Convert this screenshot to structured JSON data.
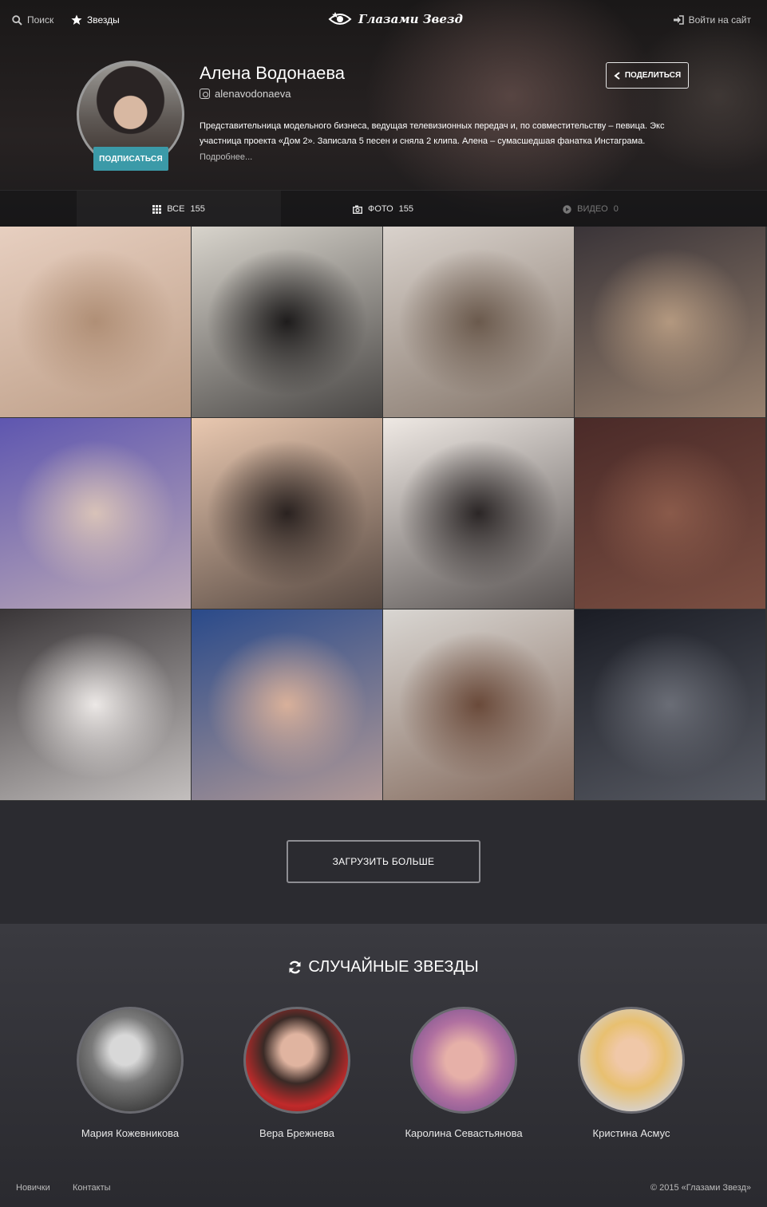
{
  "topbar": {
    "search_label": "Поиск",
    "stars_label": "Звезды",
    "logo_text": "Глазами Звезд",
    "login_label": "Войти на сайт"
  },
  "profile": {
    "name": "Алена Водонаева",
    "handle": "alenavodonaeva",
    "bio": "Представительница модельного бизнеса, ведущая телевизионных передач и, по совместительству – певица. Экс участница проекта «Дом 2». Записала 5 песен и сняла 2 клипа. Алена – сумасшедшая фанатка Инстаграма.",
    "more_label": "Подробнее...",
    "subscribe_label": "ПОДПИСАТЬСЯ",
    "share_label": "ПОДЕЛИТЬСЯ"
  },
  "tabs": [
    {
      "label": "ВСЕ",
      "count": "155",
      "icon": "grid-icon"
    },
    {
      "label": "ФОТО",
      "count": "155",
      "icon": "photo-icon"
    },
    {
      "label": "ВИДЕО",
      "count": "0",
      "icon": "play-icon"
    }
  ],
  "photos": [
    {
      "desc": "perfume-bottles",
      "c1": "#e7cfc0",
      "c2": "#b08f76"
    },
    {
      "desc": "woman-black-suit",
      "c1": "#d8d4cc",
      "c2": "#1e1c1c"
    },
    {
      "desc": "woman-leopard-dress",
      "c1": "#d9d2cc",
      "c2": "#6b5a4d"
    },
    {
      "desc": "chess-game",
      "c1": "#3a3438",
      "c2": "#b3987f"
    },
    {
      "desc": "black-face-mask",
      "c1": "#5e56b0",
      "c2": "#d8c2b8"
    },
    {
      "desc": "black-cat",
      "c1": "#e9c8b0",
      "c2": "#2a2220"
    },
    {
      "desc": "woman-at-table",
      "c1": "#efe9e4",
      "c2": "#2b2626"
    },
    {
      "desc": "bookshelf",
      "c1": "#4a2a28",
      "c2": "#8a5a4a"
    },
    {
      "desc": "woman-white-suit",
      "c1": "#3a3638",
      "c2": "#ece8e6"
    },
    {
      "desc": "selfie-with-son",
      "c1": "#2a4a8a",
      "c2": "#d8b09a"
    },
    {
      "desc": "woman-leopard-top",
      "c1": "#d9d6d2",
      "c2": "#6a4a3a"
    },
    {
      "desc": "hand-fur-car",
      "c1": "#1a1c24",
      "c2": "#6a6d76"
    }
  ],
  "load_more_label": "ЗАГРУЗИТЬ БОЛЬШЕ",
  "random": {
    "title": "СЛУЧАЙНЫЕ ЗВЕЗДЫ",
    "stars": [
      {
        "name": "Мария Кожевникова"
      },
      {
        "name": "Вера Брежнева"
      },
      {
        "name": "Каролина Севастьянова"
      },
      {
        "name": "Кристина Асмус"
      }
    ]
  },
  "footer": {
    "newbies_label": "Новички",
    "contacts_label": "Контакты",
    "copyright": "© 2015 «Глазами Звезд»"
  }
}
